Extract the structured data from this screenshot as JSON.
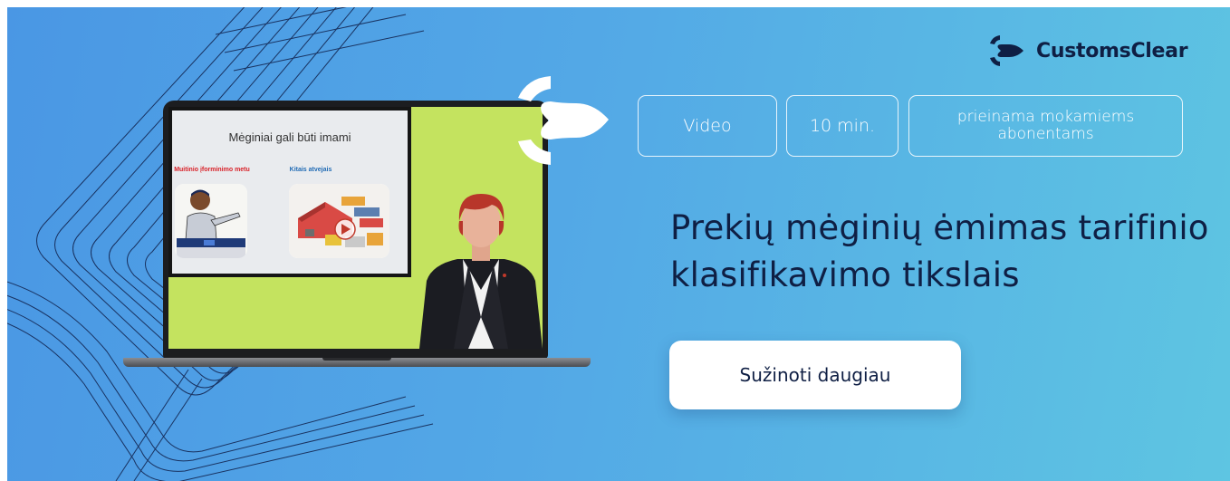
{
  "brand": {
    "name": "CustomsClear",
    "text_color": "#0f1f44"
  },
  "colors": {
    "gradient_start": "#4a97e4",
    "gradient_end": "#5ec5e2",
    "screen_background": "#c4e35f"
  },
  "icons": {
    "logo": "customsclear-arrow-logo",
    "decoration": "large-white-arrow-icon"
  },
  "tags": [
    {
      "label": "Video"
    },
    {
      "label": "10 min."
    },
    {
      "label": "prieinama mokamiems abonentams"
    }
  ],
  "headline": "Prekių mėginių ėmimas tarifinio klasifikavimo tikslais",
  "cta": {
    "label": "Sužinoti daugiau"
  },
  "video_slide": {
    "title": "Mėginiai gali būti imami",
    "left_label": "Muitinio įforminimo metu",
    "right_label": "Kitais atvejais"
  }
}
